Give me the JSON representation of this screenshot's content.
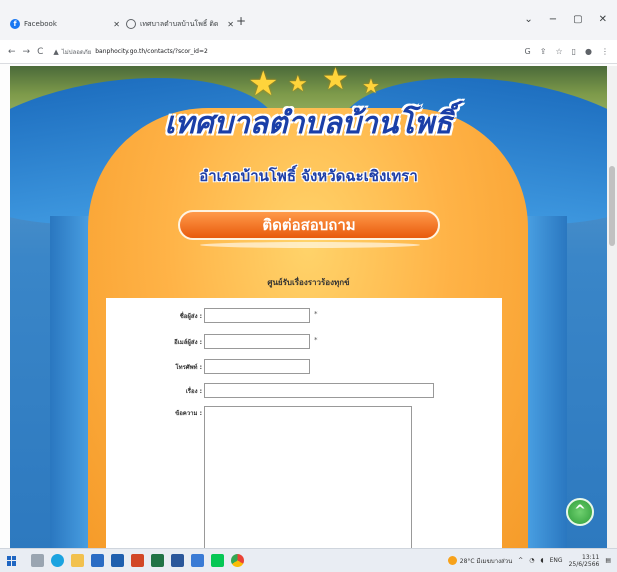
{
  "browser": {
    "tabs": [
      {
        "title": "Facebook",
        "icon": "facebook-icon"
      },
      {
        "title": "เทศบาลตำบลบ้านโพธิ์ ติดต่อ",
        "icon": "globe-icon"
      }
    ],
    "new_tab": "+",
    "window_controls": [
      "⌄",
      "−",
      "▢",
      "✕"
    ],
    "url_secure_label": "ไม่ปลอดภัย",
    "url": "banphocity.go.th/contacts/?scor_id=2"
  },
  "site": {
    "title": "เทศบาลตำบลบ้านโพธิ์",
    "subtitle": "อำเภอบ้านโพธิ์ จังหวัดฉะเชิงเทรา",
    "banner": "ติดต่อสอบถาม",
    "section_heading": "ศูนย์รับเรื่องราวร้องทุกข์"
  },
  "form": {
    "fields": [
      {
        "label": "ชื่อผู้ส่ง :",
        "value": "",
        "required": "*"
      },
      {
        "label": "อีเมล์ผู้ส่ง :",
        "value": "",
        "required": "*"
      },
      {
        "label": "โทรศัพท์ :",
        "value": ""
      },
      {
        "label": "เรื่อง :",
        "value": ""
      },
      {
        "label": "ข้อความ :",
        "value": ""
      }
    ]
  },
  "scroll_top_label": "^",
  "taskbar": {
    "weather": "28°C มีเมฆบางส่วน",
    "time": "13:11",
    "date": "25/6/2566",
    "lang": "ENG"
  },
  "colors": {
    "accent_blue": "#2d79bf",
    "panel_orange": "#ffb347",
    "banner_orange": "#e85a0c"
  }
}
